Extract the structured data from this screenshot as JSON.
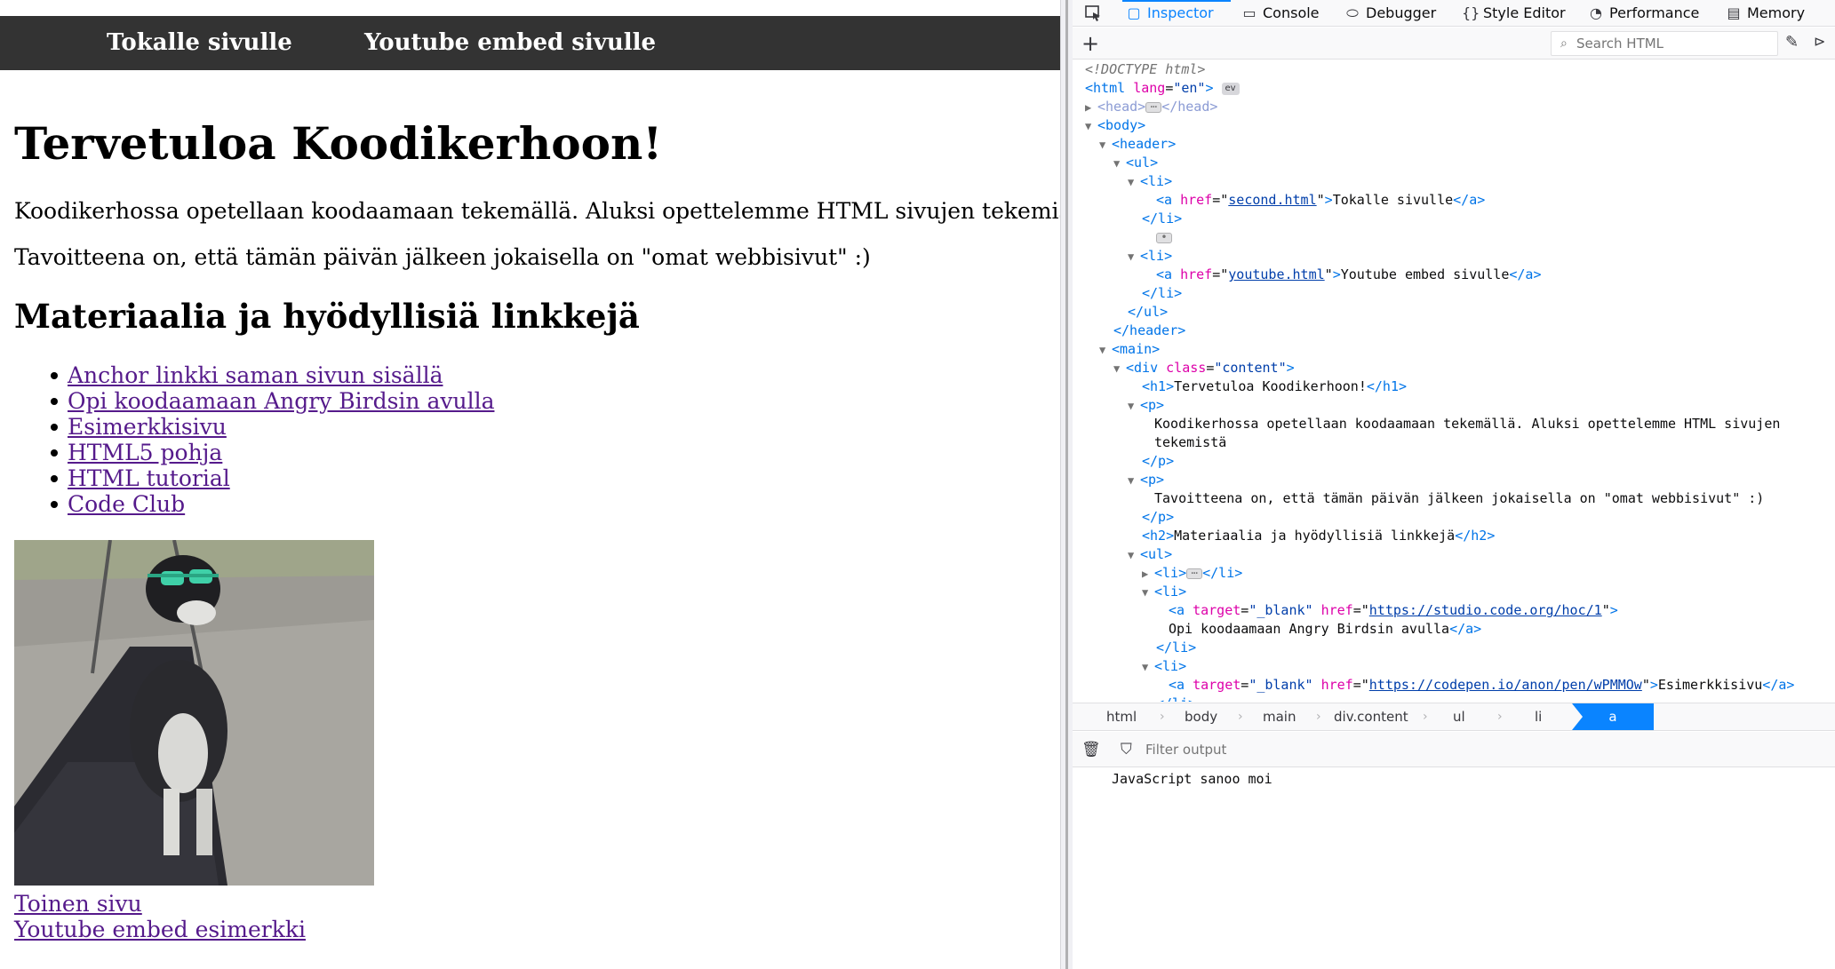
{
  "page": {
    "nav": [
      "Tokalle sivulle",
      "Youtube embed sivulle"
    ],
    "title": "Tervetuloa Koodikerhoon!",
    "paragraphs": [
      "Koodikerhossa opetellaan koodaamaan tekemällä. Aluksi opettelemme HTML sivujen tekemistä",
      "Tavoitteena on, että tämän päivän jälkeen jokaisella on \"omat webbisivut\" :)"
    ],
    "section_title": "Materiaalia ja hyödyllisiä linkkejä",
    "links": [
      "Anchor linkki saman sivun sisällä",
      "Opi koodaamaan Angry Birdsin avulla",
      "Esimerkkisivu",
      "HTML5 pohja",
      "HTML tutorial",
      "Code Club"
    ],
    "bottom_links": [
      "Toinen sivu",
      "Youtube embed esimerkki"
    ],
    "colors": {
      "navbar_bg": "#333333",
      "visited_link": "#551a8b"
    }
  },
  "devtools": {
    "tabs": [
      {
        "label": "Inspector",
        "icon": "inspector-icon",
        "active": true
      },
      {
        "label": "Console",
        "icon": "console-icon"
      },
      {
        "label": "Debugger",
        "icon": "debugger-icon"
      },
      {
        "label": "Style Editor",
        "icon": "style-editor-icon"
      },
      {
        "label": "Performance",
        "icon": "performance-icon"
      },
      {
        "label": "Memory",
        "icon": "memory-icon"
      }
    ],
    "search_placeholder": "Search HTML",
    "markup": {
      "doctype": "<!DOCTYPE html>",
      "html_lang": "\"en\"",
      "ev_badge": "ev",
      "href_second": "second.html",
      "text_second": "Tokalle sivulle",
      "href_youtube": "youtube.html",
      "text_youtube": "Youtube embed sivulle",
      "class_content": "\"content\"",
      "h1_text": "Tervetuloa Koodikerhoon!",
      "p1_line1": "Koodikerhossa opetellaan koodaamaan tekemällä. Aluksi opettelemme HTML sivujen",
      "p1_line2": "tekemistä",
      "p2_text": "Tavoitteena on, että tämän päivän jälkeen jokaisella on \"omat webbisivut\" :)",
      "h2_text": "Materiaalia ja hyödyllisiä linkkejä",
      "target_blank": "\"_blank\"",
      "href_studio": "https://studio.code.org/hoc/1",
      "text_studio": "Opi koodaamaan Angry Birdsin avulla",
      "href_codepen": "https://codepen.io/anon/pen/wPMMOw",
      "text_codepen": "Esimerkkisivu"
    },
    "breadcrumbs": [
      "html",
      "body",
      "main",
      "div.content",
      "ul",
      "li",
      "a"
    ],
    "console": {
      "filter_placeholder": "Filter output",
      "messages": [
        "JavaScript sanoo moi"
      ]
    },
    "colors": {
      "accent": "#0a84ff",
      "tag": "#0074e8",
      "attr": "#dd00a9",
      "value": "#003eaa"
    }
  }
}
